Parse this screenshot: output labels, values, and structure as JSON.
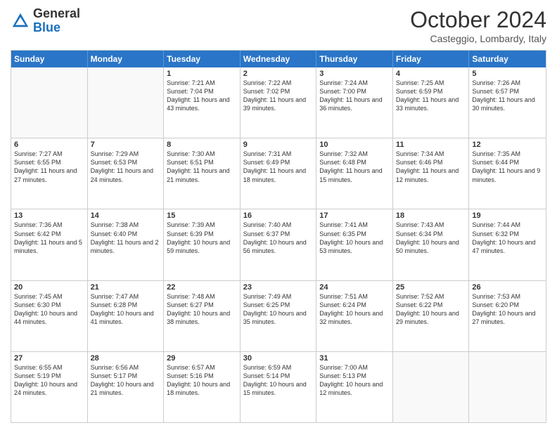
{
  "header": {
    "logo": {
      "general": "General",
      "blue": "Blue"
    },
    "title": "October 2024",
    "location": "Casteggio, Lombardy, Italy"
  },
  "calendar": {
    "days": [
      "Sunday",
      "Monday",
      "Tuesday",
      "Wednesday",
      "Thursday",
      "Friday",
      "Saturday"
    ],
    "rows": [
      [
        {
          "day": "",
          "empty": true
        },
        {
          "day": "",
          "empty": true
        },
        {
          "day": "1",
          "sunrise": "Sunrise: 7:21 AM",
          "sunset": "Sunset: 7:04 PM",
          "daylight": "Daylight: 11 hours and 43 minutes."
        },
        {
          "day": "2",
          "sunrise": "Sunrise: 7:22 AM",
          "sunset": "Sunset: 7:02 PM",
          "daylight": "Daylight: 11 hours and 39 minutes."
        },
        {
          "day": "3",
          "sunrise": "Sunrise: 7:24 AM",
          "sunset": "Sunset: 7:00 PM",
          "daylight": "Daylight: 11 hours and 36 minutes."
        },
        {
          "day": "4",
          "sunrise": "Sunrise: 7:25 AM",
          "sunset": "Sunset: 6:59 PM",
          "daylight": "Daylight: 11 hours and 33 minutes."
        },
        {
          "day": "5",
          "sunrise": "Sunrise: 7:26 AM",
          "sunset": "Sunset: 6:57 PM",
          "daylight": "Daylight: 11 hours and 30 minutes."
        }
      ],
      [
        {
          "day": "6",
          "sunrise": "Sunrise: 7:27 AM",
          "sunset": "Sunset: 6:55 PM",
          "daylight": "Daylight: 11 hours and 27 minutes."
        },
        {
          "day": "7",
          "sunrise": "Sunrise: 7:29 AM",
          "sunset": "Sunset: 6:53 PM",
          "daylight": "Daylight: 11 hours and 24 minutes."
        },
        {
          "day": "8",
          "sunrise": "Sunrise: 7:30 AM",
          "sunset": "Sunset: 6:51 PM",
          "daylight": "Daylight: 11 hours and 21 minutes."
        },
        {
          "day": "9",
          "sunrise": "Sunrise: 7:31 AM",
          "sunset": "Sunset: 6:49 PM",
          "daylight": "Daylight: 11 hours and 18 minutes."
        },
        {
          "day": "10",
          "sunrise": "Sunrise: 7:32 AM",
          "sunset": "Sunset: 6:48 PM",
          "daylight": "Daylight: 11 hours and 15 minutes."
        },
        {
          "day": "11",
          "sunrise": "Sunrise: 7:34 AM",
          "sunset": "Sunset: 6:46 PM",
          "daylight": "Daylight: 11 hours and 12 minutes."
        },
        {
          "day": "12",
          "sunrise": "Sunrise: 7:35 AM",
          "sunset": "Sunset: 6:44 PM",
          "daylight": "Daylight: 11 hours and 9 minutes."
        }
      ],
      [
        {
          "day": "13",
          "sunrise": "Sunrise: 7:36 AM",
          "sunset": "Sunset: 6:42 PM",
          "daylight": "Daylight: 11 hours and 5 minutes."
        },
        {
          "day": "14",
          "sunrise": "Sunrise: 7:38 AM",
          "sunset": "Sunset: 6:40 PM",
          "daylight": "Daylight: 11 hours and 2 minutes."
        },
        {
          "day": "15",
          "sunrise": "Sunrise: 7:39 AM",
          "sunset": "Sunset: 6:39 PM",
          "daylight": "Daylight: 10 hours and 59 minutes."
        },
        {
          "day": "16",
          "sunrise": "Sunrise: 7:40 AM",
          "sunset": "Sunset: 6:37 PM",
          "daylight": "Daylight: 10 hours and 56 minutes."
        },
        {
          "day": "17",
          "sunrise": "Sunrise: 7:41 AM",
          "sunset": "Sunset: 6:35 PM",
          "daylight": "Daylight: 10 hours and 53 minutes."
        },
        {
          "day": "18",
          "sunrise": "Sunrise: 7:43 AM",
          "sunset": "Sunset: 6:34 PM",
          "daylight": "Daylight: 10 hours and 50 minutes."
        },
        {
          "day": "19",
          "sunrise": "Sunrise: 7:44 AM",
          "sunset": "Sunset: 6:32 PM",
          "daylight": "Daylight: 10 hours and 47 minutes."
        }
      ],
      [
        {
          "day": "20",
          "sunrise": "Sunrise: 7:45 AM",
          "sunset": "Sunset: 6:30 PM",
          "daylight": "Daylight: 10 hours and 44 minutes."
        },
        {
          "day": "21",
          "sunrise": "Sunrise: 7:47 AM",
          "sunset": "Sunset: 6:28 PM",
          "daylight": "Daylight: 10 hours and 41 minutes."
        },
        {
          "day": "22",
          "sunrise": "Sunrise: 7:48 AM",
          "sunset": "Sunset: 6:27 PM",
          "daylight": "Daylight: 10 hours and 38 minutes."
        },
        {
          "day": "23",
          "sunrise": "Sunrise: 7:49 AM",
          "sunset": "Sunset: 6:25 PM",
          "daylight": "Daylight: 10 hours and 35 minutes."
        },
        {
          "day": "24",
          "sunrise": "Sunrise: 7:51 AM",
          "sunset": "Sunset: 6:24 PM",
          "daylight": "Daylight: 10 hours and 32 minutes."
        },
        {
          "day": "25",
          "sunrise": "Sunrise: 7:52 AM",
          "sunset": "Sunset: 6:22 PM",
          "daylight": "Daylight: 10 hours and 29 minutes."
        },
        {
          "day": "26",
          "sunrise": "Sunrise: 7:53 AM",
          "sunset": "Sunset: 6:20 PM",
          "daylight": "Daylight: 10 hours and 27 minutes."
        }
      ],
      [
        {
          "day": "27",
          "sunrise": "Sunrise: 6:55 AM",
          "sunset": "Sunset: 5:19 PM",
          "daylight": "Daylight: 10 hours and 24 minutes."
        },
        {
          "day": "28",
          "sunrise": "Sunrise: 6:56 AM",
          "sunset": "Sunset: 5:17 PM",
          "daylight": "Daylight: 10 hours and 21 minutes."
        },
        {
          "day": "29",
          "sunrise": "Sunrise: 6:57 AM",
          "sunset": "Sunset: 5:16 PM",
          "daylight": "Daylight: 10 hours and 18 minutes."
        },
        {
          "day": "30",
          "sunrise": "Sunrise: 6:59 AM",
          "sunset": "Sunset: 5:14 PM",
          "daylight": "Daylight: 10 hours and 15 minutes."
        },
        {
          "day": "31",
          "sunrise": "Sunrise: 7:00 AM",
          "sunset": "Sunset: 5:13 PM",
          "daylight": "Daylight: 10 hours and 12 minutes."
        },
        {
          "day": "",
          "empty": true
        },
        {
          "day": "",
          "empty": true
        }
      ]
    ]
  }
}
